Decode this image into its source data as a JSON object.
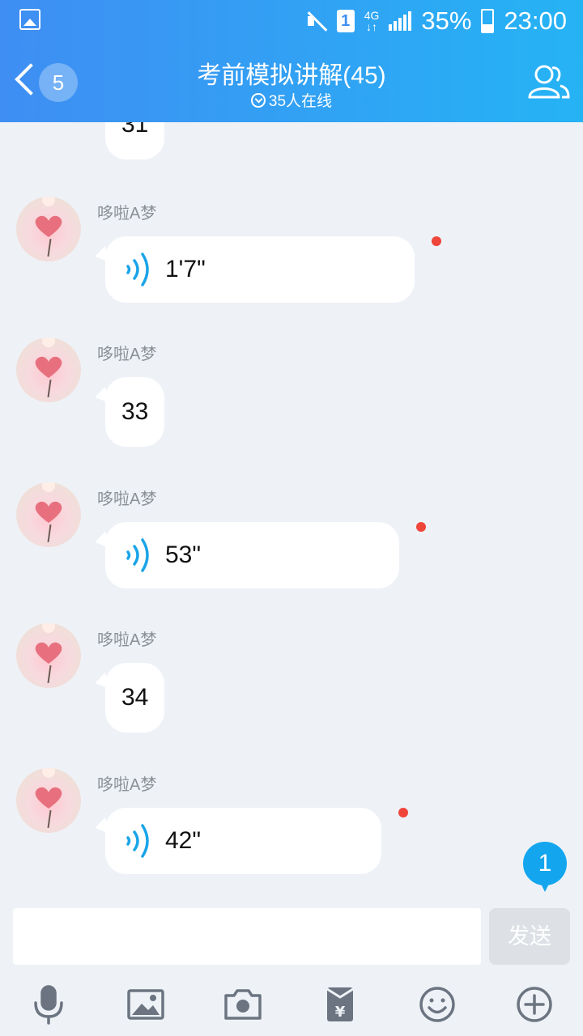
{
  "status_bar": {
    "battery": "35%",
    "time": "23:00",
    "network": "4G",
    "sim": "1"
  },
  "header": {
    "back_count": "5",
    "title": "考前模拟讲解(45)",
    "online": "35人在线"
  },
  "messages": [
    {
      "type": "text",
      "content": "31"
    },
    {
      "type": "voice",
      "sender": "哆啦A梦",
      "content": "1'7\"",
      "unheard": true
    },
    {
      "type": "text",
      "sender": "哆啦A梦",
      "content": "33"
    },
    {
      "type": "voice",
      "sender": "哆啦A梦",
      "content": "53\"",
      "unheard": true
    },
    {
      "type": "text",
      "sender": "哆啦A梦",
      "content": "34"
    },
    {
      "type": "voice",
      "sender": "哆啦A梦",
      "content": "42\"",
      "unheard": true
    }
  ],
  "new_messages_badge": "1",
  "input": {
    "value": "",
    "placeholder": "",
    "send_label": "发送"
  },
  "toolbar": {
    "items": [
      "microphone-icon",
      "image-icon",
      "camera-icon",
      "red-packet-icon",
      "emoji-icon",
      "plus-icon"
    ]
  },
  "colors": {
    "accent": "#13a6ee",
    "header_start": "#3f8ef3",
    "header_end": "#25b3f4",
    "unread_dot": "#f0453a"
  }
}
